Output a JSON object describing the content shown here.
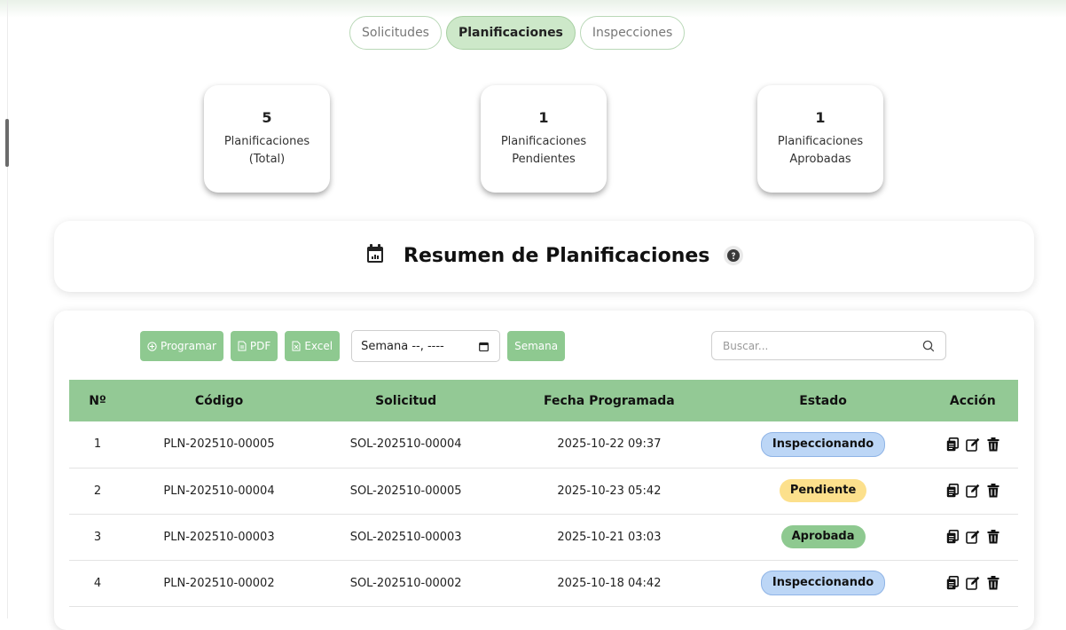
{
  "tabs": [
    {
      "label": "Solicitudes",
      "active": false
    },
    {
      "label": "Planificaciones",
      "active": true
    },
    {
      "label": "Inspecciones",
      "active": false
    }
  ],
  "stats": [
    {
      "value": "5",
      "label": "Planificaciones (Total)"
    },
    {
      "value": "1",
      "label": "Planificaciones Pendientes"
    },
    {
      "value": "1",
      "label": "Planificaciones Aprobadas"
    }
  ],
  "summary": {
    "title": "Resumen de Planificaciones",
    "icon": "calendar-icon"
  },
  "toolbar": {
    "programar_label": "Programar",
    "pdf_label": "PDF",
    "excel_label": "Excel",
    "week_value": "Semana --, ----",
    "week_button_label": "Semana",
    "search_placeholder": "Buscar..."
  },
  "table": {
    "headers": [
      "Nº",
      "Código",
      "Solicitud",
      "Fecha Programada",
      "Estado",
      "Acción"
    ],
    "rows": [
      {
        "n": "1",
        "codigo": "PLN-202510-00005",
        "solicitud": "SOL-202510-00004",
        "fecha": "2025-10-22 09:37",
        "estado": "Inspeccionando"
      },
      {
        "n": "2",
        "codigo": "PLN-202510-00004",
        "solicitud": "SOL-202510-00005",
        "fecha": "2025-10-23 05:42",
        "estado": "Pendiente"
      },
      {
        "n": "3",
        "codigo": "PLN-202510-00003",
        "solicitud": "SOL-202510-00003",
        "fecha": "2025-10-21 03:03",
        "estado": "Aprobada"
      },
      {
        "n": "4",
        "codigo": "PLN-202510-00002",
        "solicitud": "SOL-202510-00002",
        "fecha": "2025-10-18 04:42",
        "estado": "Inspeccionando"
      }
    ]
  },
  "colors": {
    "accent": "#8ec990",
    "header_bg": "#93c995",
    "tab_active_bg": "#cde8c9",
    "inspeccionando_bg": "#bcd6f6",
    "pendiente_bg": "#fce08c",
    "aprobada_bg": "#8ec990"
  }
}
